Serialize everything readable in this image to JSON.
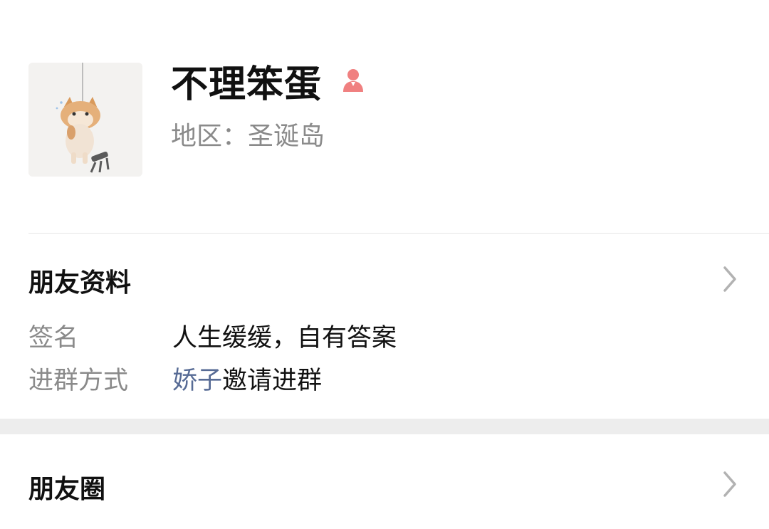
{
  "profile": {
    "nickname": "不理笨蛋",
    "region": "地区：圣诞岛",
    "gender_icon": "female-person-icon",
    "gender_color": "#f08080",
    "avatar_icon": "hanging-cat-avatar"
  },
  "friend_info": {
    "title": "朋友资料",
    "signature_label": "签名",
    "signature_value": "人生缓缓，自有答案",
    "join_label": "进群方式",
    "inviter": "娇子",
    "join_suffix": "邀请进群",
    "link_color": "#576b95"
  },
  "moments": {
    "title": "朋友圈"
  }
}
